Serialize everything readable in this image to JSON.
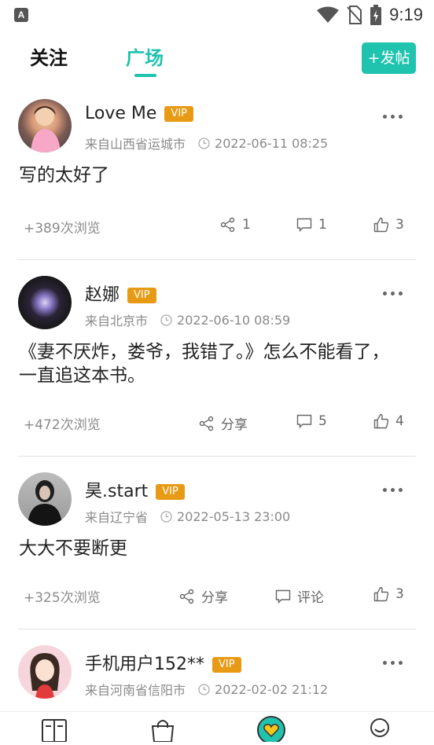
{
  "status": {
    "time": "9:19",
    "app_icon_letter": "A"
  },
  "tabs": {
    "follow": "关注",
    "square": "广场"
  },
  "post_button": "+发帖",
  "posts": [
    {
      "name": "Love Me",
      "vip": "VIP",
      "location": "来自山西省运城市",
      "time": "2022-06-11 08:25",
      "content": "写的太好了",
      "views": "+389次浏览",
      "share": "1",
      "comment": "1",
      "like": "3"
    },
    {
      "name": "赵娜",
      "vip": "VIP",
      "location": "来自北京市",
      "time": "2022-06-10 08:59",
      "content": "《妻不厌炸，娄爷，我错了。》怎么不能看了，一直追这本书。",
      "views": "+472次浏览",
      "share": "分享",
      "comment": "5",
      "like": "4"
    },
    {
      "name": "昊.start",
      "vip": "VIP",
      "location": "来自辽宁省",
      "time": "2022-05-13 23:00",
      "content": "大大不要断更",
      "views": "+325次浏览",
      "share": "分享",
      "comment": "评论",
      "like": "3"
    },
    {
      "name": "手机用户152**",
      "vip": "VIP",
      "location": "来自河南省信阳市",
      "time": "2022-02-02 21:12",
      "content": "",
      "views": "",
      "share": "",
      "comment": "",
      "like": ""
    }
  ],
  "colors": {
    "accent": "#1fc3ae",
    "vip": "#e89a15"
  },
  "bottom_nav_icons": [
    "bookshelf-icon",
    "store-bag-icon",
    "square-heart-icon",
    "profile-icon"
  ]
}
